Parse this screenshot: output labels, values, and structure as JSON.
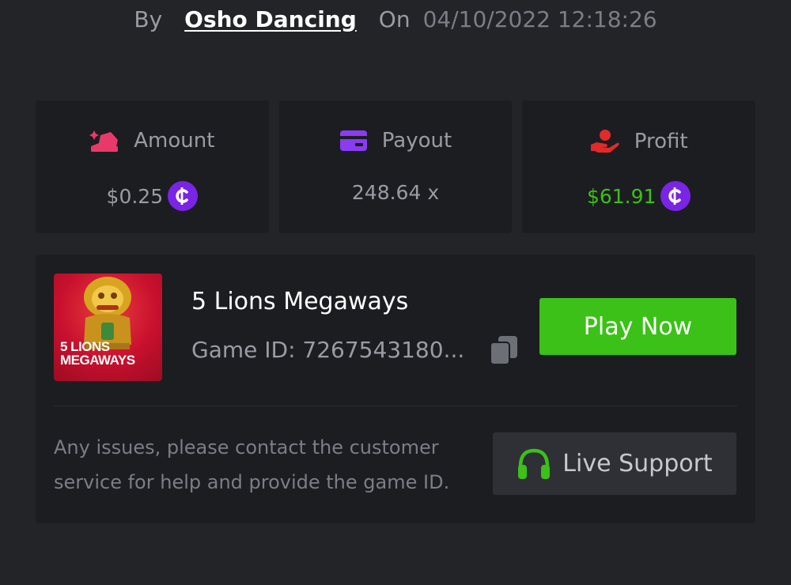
{
  "header": {
    "by_label": "By",
    "username": "Osho Dancing",
    "on_label": "On",
    "timestamp": "04/10/2022 12:18:26"
  },
  "stats": {
    "amount": {
      "label": "Amount",
      "value": "$0.25",
      "icon": "bet-amount-icon"
    },
    "payout": {
      "label": "Payout",
      "value": "248.64 x",
      "icon": "card-icon"
    },
    "profit": {
      "label": "Profit",
      "value": "$61.91",
      "icon": "hand-coin-icon"
    }
  },
  "currency": {
    "symbol": "₵",
    "icon": "coin-icon",
    "color": "#7a24e6"
  },
  "game": {
    "name": "5 Lions Megaways",
    "id_label": "Game ID: 7267543180...",
    "thumbnail_text_line1": "5 LIONS",
    "thumbnail_text_line2": "MEGAWAYS",
    "play_label": "Play Now"
  },
  "support": {
    "help_text": "Any issues, please contact the customer service for help and provide the game ID.",
    "button_label": "Live Support",
    "icon": "headset-icon"
  },
  "colors": {
    "background": "#232428",
    "card": "#1c1d21",
    "accent_green": "#3bc117",
    "muted_text": "#9a9ca3",
    "amount_icon": "#e83a6a",
    "payout_icon": "#8a3cf0",
    "profit_icon": "#e22a2a"
  }
}
